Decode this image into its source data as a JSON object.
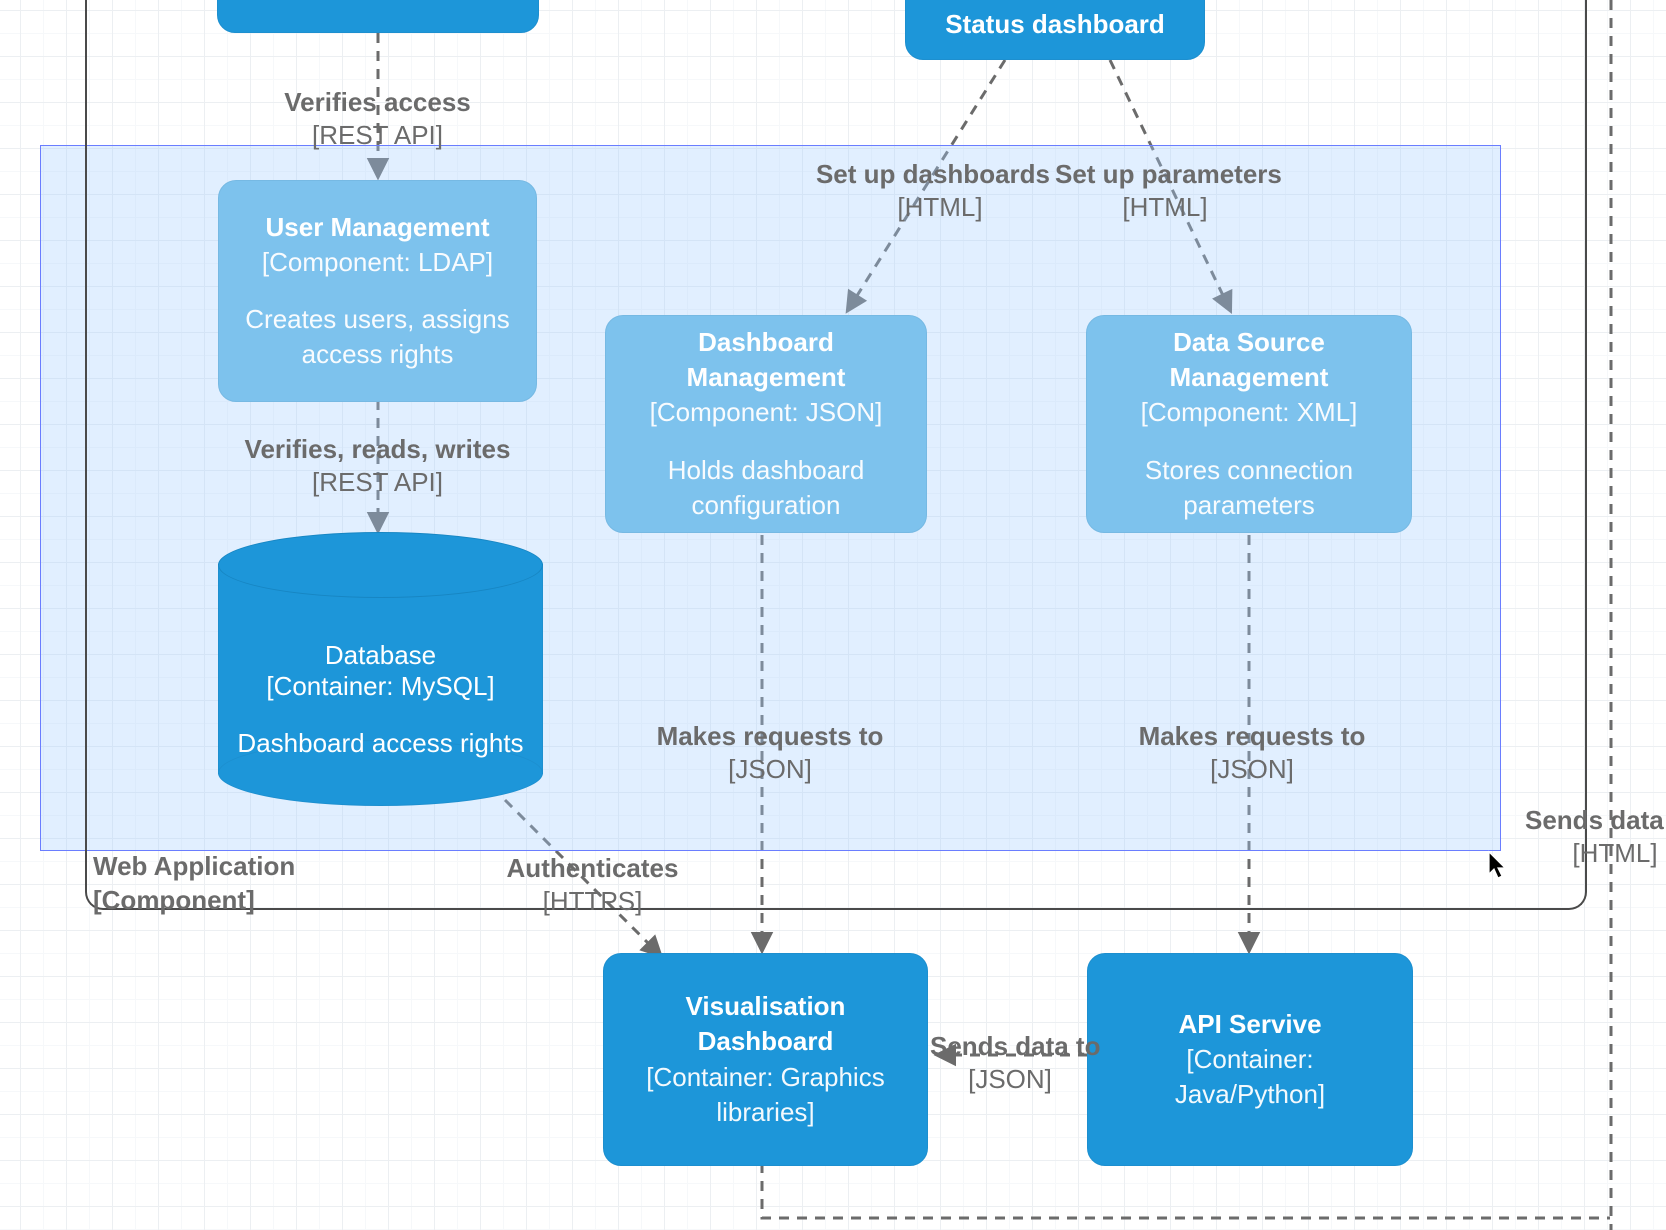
{
  "frame": {
    "label_line1": "Web Application",
    "label_line2": "[Component]"
  },
  "nodes": {
    "status_dashboard": {
      "title": "Status dashboard"
    },
    "top_left_box": {
      "title": ""
    },
    "user_mgmt": {
      "title": "User Management",
      "sub": "[Component: LDAP]",
      "desc1": "Creates users, assigns",
      "desc2": "access rights"
    },
    "dash_mgmt": {
      "title": "Dashboard Management",
      "sub": "[Component: JSON]",
      "desc1": "Holds dashboard",
      "desc2": "configuration"
    },
    "ds_mgmt": {
      "title": "Data Source Management",
      "sub": "[Component: XML]",
      "desc1": "Stores connection",
      "desc2": "parameters"
    },
    "db": {
      "title": "Database",
      "sub": "[Container: MySQL]",
      "desc": "Dashboard access rights"
    },
    "vis": {
      "title": "Visualisation Dashboard",
      "sub1": "[Container: Graphics",
      "sub2": "libraries]"
    },
    "api": {
      "title": "API Servive",
      "sub": "[Container: Java/Python]"
    }
  },
  "edges": {
    "verifies_access": {
      "l1": "Verifies access",
      "l2": "[REST API]"
    },
    "setup_dashboards": {
      "l1": "Set up dashboards",
      "l2": "[HTML]"
    },
    "setup_parameters": {
      "l1": "Set up parameters",
      "l2": "[HTML]"
    },
    "verifies_rw": {
      "l1": "Verifies, reads, writes",
      "l2": "[REST API]"
    },
    "makes_req_1": {
      "l1": "Makes requests to",
      "l2": "[JSON]"
    },
    "makes_req_2": {
      "l1": "Makes requests to",
      "l2": "[JSON]"
    },
    "authenticates": {
      "l1": "Authenticates",
      "l2": "[HTTPS]"
    },
    "sends_data_json": {
      "l1": "Sends data to",
      "l2": "[JSON]"
    },
    "sends_data_html": {
      "l1": "Sends data to",
      "l2": "[HTML]"
    }
  }
}
